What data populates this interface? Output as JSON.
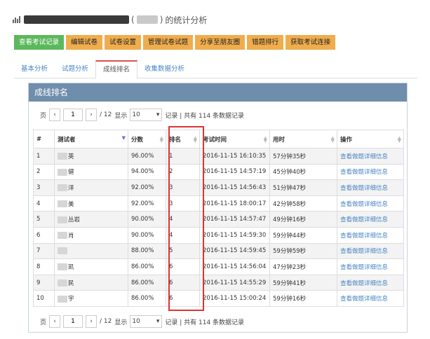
{
  "page": {
    "title_suffix": "的统计分析",
    "title_paren_open": "(",
    "title_paren_close": ")"
  },
  "toolbar": [
    {
      "label": "查看考试记录",
      "primary": true
    },
    {
      "label": "编辑试卷"
    },
    {
      "label": "试卷设置"
    },
    {
      "label": "管理试卷试题"
    },
    {
      "label": "分享至朋友圈"
    },
    {
      "label": "错题排行"
    },
    {
      "label": "获取考试连接"
    }
  ],
  "tabs": [
    {
      "label": "基本分析"
    },
    {
      "label": "试题分析"
    },
    {
      "label": "成线排名",
      "active": true
    },
    {
      "label": "收集数据分析"
    }
  ],
  "panel": {
    "title": "成线排名"
  },
  "pager": {
    "page_label": "页",
    "prev": "‹",
    "current_page": "1",
    "next": "›",
    "total_pages": "/ 12",
    "show_label": "显示",
    "page_size": "10",
    "summary": "记录 | 共有 114 条数据记录"
  },
  "table": {
    "headers": [
      "#",
      "测试者",
      "分数",
      "排名",
      "考试时间",
      "用时",
      "操作"
    ],
    "rows": [
      {
        "no": "1",
        "name": "英",
        "score": "96.00%",
        "rank": "1",
        "time": "2016-11-15 16:10:35",
        "duration": "57分钟35秒",
        "action": "查看做题详细信息"
      },
      {
        "no": "2",
        "name": "健",
        "score": "94.00%",
        "rank": "2",
        "time": "2016-11-15 14:57:19",
        "duration": "45分钟40秒",
        "action": "查看做题详细信息"
      },
      {
        "no": "3",
        "name": "洋",
        "score": "92.00%",
        "rank": "3",
        "time": "2016-11-15 14:56:43",
        "duration": "51分钟47秒",
        "action": "查看做题详细信息"
      },
      {
        "no": "4",
        "name": "美",
        "score": "92.00%",
        "rank": "3",
        "time": "2016-11-15 18:00:17",
        "duration": "42分钟58秒",
        "action": "查看做题详细信息"
      },
      {
        "no": "5",
        "name": "丛岩",
        "score": "90.00%",
        "rank": "4",
        "time": "2016-11-15 14:57:47",
        "duration": "49分钟16秒",
        "action": "查看做题详细信息"
      },
      {
        "no": "6",
        "name": "肖",
        "score": "90.00%",
        "rank": "4",
        "time": "2016-11-15 14:59:30",
        "duration": "59分钟44秒",
        "action": "查看做题详细信息"
      },
      {
        "no": "7",
        "name": "",
        "score": "88.00%",
        "rank": "5",
        "time": "2016-11-15 14:59:45",
        "duration": "59分钟59秒",
        "action": "查看做题详细信息"
      },
      {
        "no": "8",
        "name": "凯",
        "score": "86.00%",
        "rank": "6",
        "time": "2016-11-15 14:56:04",
        "duration": "47分钟23秒",
        "action": "查看做题详细信息"
      },
      {
        "no": "9",
        "name": "民",
        "score": "86.00%",
        "rank": "6",
        "time": "2016-11-15 14:55:29",
        "duration": "59分钟41秒",
        "action": "查看做题详细信息"
      },
      {
        "no": "10",
        "name": "宇",
        "score": "86.00%",
        "rank": "6",
        "time": "2016-11-15 15:00:24",
        "duration": "59分钟16秒",
        "action": "查看做题详细信息"
      }
    ]
  },
  "colors": {
    "primary_button": "#5cb85c",
    "warning_button": "#f0ad4e",
    "panel_heading": "#6f8eab",
    "link": "#4a86c5",
    "highlight_box": "#dd3333"
  },
  "icons": {
    "title": "bar-chart-icon",
    "sort": "sort-arrows-icon",
    "dropdown": "caret-down-icon"
  }
}
